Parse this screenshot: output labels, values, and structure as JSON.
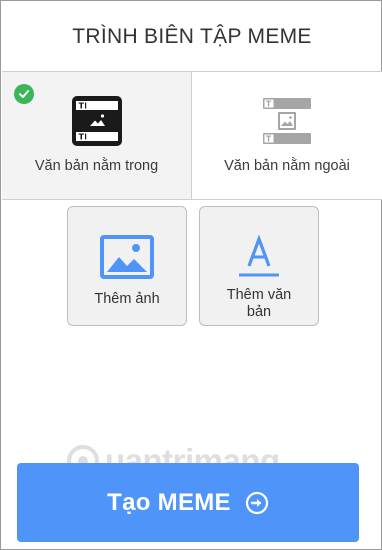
{
  "header": {
    "title": "TRÌNH BIÊN TẬP MEME"
  },
  "layouts": [
    {
      "label": "Văn bản nằm trong",
      "selected": true,
      "icon": "text-inside-icon"
    },
    {
      "label": "Văn bản nằm ngoài",
      "selected": false,
      "icon": "text-outside-icon"
    }
  ],
  "tools": {
    "add_image": {
      "label": "Thêm ảnh",
      "icon": "image-icon"
    },
    "add_text": {
      "label": "Thêm văn bản",
      "icon": "text-icon"
    }
  },
  "watermark": {
    "text": "uantrimang"
  },
  "create_button": {
    "label": "Tạo MEME",
    "icon": "arrow-circle-right-icon"
  },
  "colors": {
    "accent_blue": "#4f94f8",
    "check_green": "#3cb55a",
    "icon_dark": "#1a1a1a",
    "icon_gray": "#9e9e9e"
  }
}
